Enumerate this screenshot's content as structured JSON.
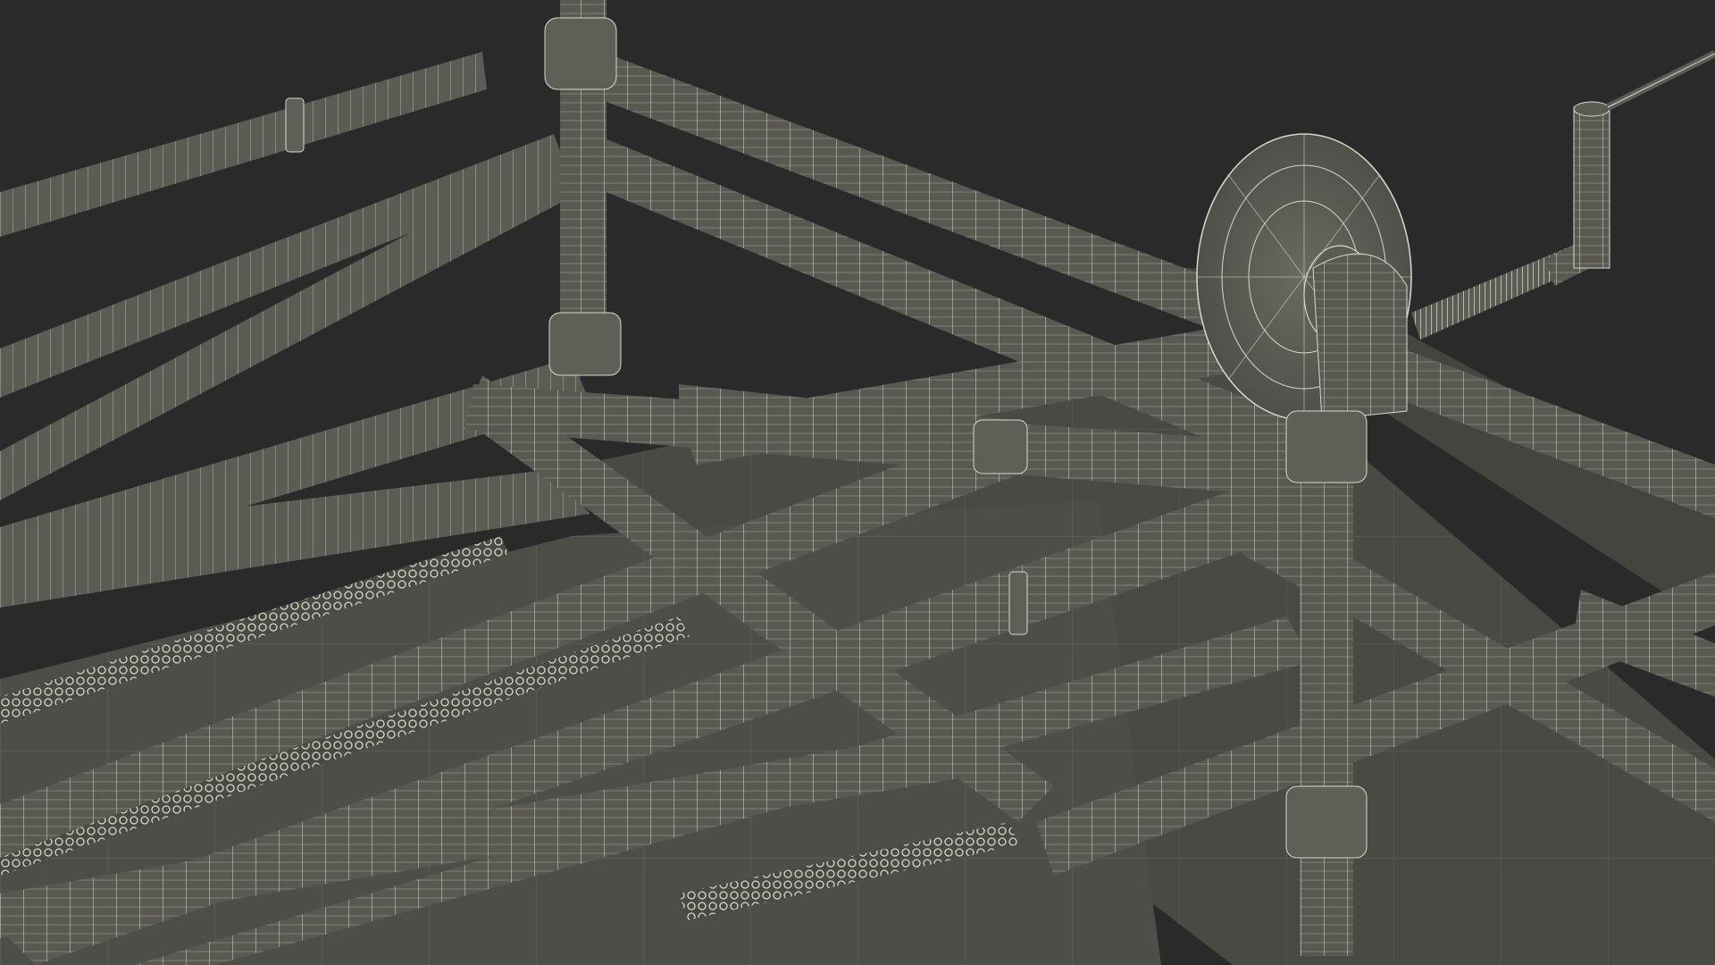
{
  "scene": {
    "subject": "wireframe-pipe-frame-model",
    "colors": {
      "background": "#2a2a2a",
      "pipe_fill": "#5c5c54",
      "pipe_shade": "#4a4a44",
      "wire": "#d8d8cc",
      "floor": "#4f4f49",
      "floor_dark": "#3f3f3a"
    },
    "icons": [
      "crank-wheel-icon",
      "threaded-rod-icon",
      "spring-icon"
    ]
  }
}
